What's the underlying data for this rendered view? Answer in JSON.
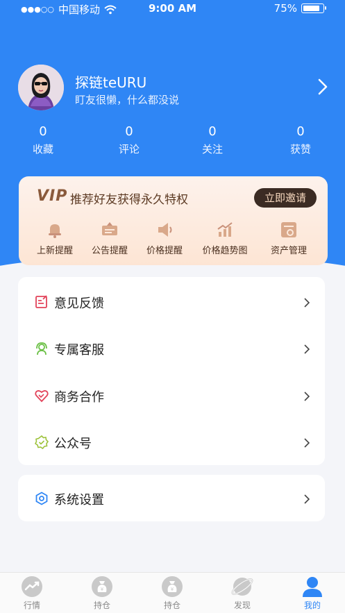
{
  "status_bar": {
    "carrier": "中国移动",
    "time": "9:00 AM",
    "battery": "75%"
  },
  "profile": {
    "username": "探链teURU",
    "bio": "盯友很懒，什么都没说"
  },
  "stats": [
    {
      "value": "0",
      "label": "收藏"
    },
    {
      "value": "0",
      "label": "评论"
    },
    {
      "value": "0",
      "label": "关注"
    },
    {
      "value": "0",
      "label": "获赞"
    }
  ],
  "vip": {
    "badge": "VIP",
    "title": "推荐好友获得永久特权",
    "invite_label": "立即邀请",
    "perks": [
      {
        "label": "上新提醒",
        "icon": "bell-icon"
      },
      {
        "label": "公告提醒",
        "icon": "notice-icon"
      },
      {
        "label": "价格提醒",
        "icon": "speaker-icon"
      },
      {
        "label": "价格趋势图",
        "icon": "trend-chart-icon"
      },
      {
        "label": "资产管理",
        "icon": "asset-icon"
      }
    ]
  },
  "menu": {
    "items": [
      {
        "label": "意见反馈",
        "icon": "feedback-icon",
        "color": "#e2435a"
      },
      {
        "label": "专属客服",
        "icon": "customer-service-icon",
        "color": "#6bc046"
      },
      {
        "label": "商务合作",
        "icon": "handshake-heart-icon",
        "color": "#e2435a"
      },
      {
        "label": "公众号",
        "icon": "official-account-icon",
        "color": "#9dc23b"
      }
    ],
    "settings": {
      "label": "系统设置",
      "icon": "settings-icon",
      "color": "#2f86f5"
    }
  },
  "tabbar": {
    "tabs": [
      {
        "label": "行情",
        "icon": "market-icon",
        "active": false
      },
      {
        "label": "持仓",
        "icon": "holdings-bag-icon",
        "active": false
      },
      {
        "label": "持仓",
        "icon": "holdings-bag-icon",
        "active": false
      },
      {
        "label": "发现",
        "icon": "discover-planet-icon",
        "active": false
      },
      {
        "label": "我的",
        "icon": "profile-icon",
        "active": true
      }
    ]
  },
  "colors": {
    "primary": "#2f86f5",
    "vip_dark": "#3b2b23",
    "vip_text": "#5c3a23"
  }
}
